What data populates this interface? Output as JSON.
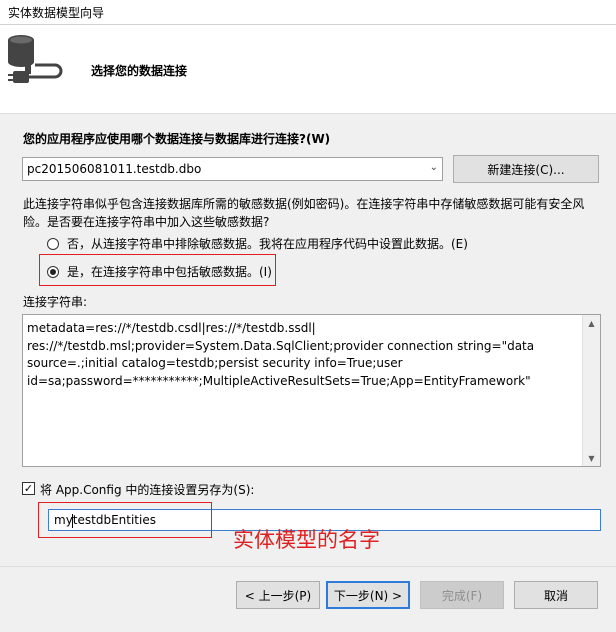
{
  "window": {
    "title": "实体数据模型向导"
  },
  "header": {
    "subtitle": "选择您的数据连接"
  },
  "connection_question": "您的应用程序应使用哪个数据连接与数据库进行连接?(W)",
  "connection_select": {
    "value": "pc201506081011.testdb.dbo"
  },
  "new_connection_label": "新建连接(C)...",
  "warning_text": "此连接字符串似乎包含连接数据库所需的敏感数据(例如密码)。在连接字符串中存储敏感数据可能有安全风险。是否要在连接字符串中加入这些敏感数据?",
  "options": {
    "exclude_label": "否，从连接字符串中排除敏感数据。我将在应用程序代码中设置此数据。(E)",
    "include_label": "是，在连接字符串中包括敏感数据。(I)",
    "selected": "include"
  },
  "connection_string_label": "连接字符串:",
  "connection_string": "metadata=res://*/testdb.csdl|res://*/testdb.ssdl|\nres://*/testdb.msl;provider=System.Data.SqlClient;provider connection string=\"data\nsource=.;initial catalog=testdb;persist security info=True;user\nid=sa;password=***********;MultipleActiveResultSets=True;App=EntityFramework\"",
  "save_config": {
    "checked": true,
    "label": "将 App.Config 中的连接设置另存为(S):"
  },
  "entities_name": "mytestdbEntities",
  "annotation": "实体模型的名字",
  "buttons": {
    "prev": "< 上一步(P)",
    "next": "下一步(N) >",
    "finish": "完成(F)",
    "cancel": "取消"
  },
  "colors": {
    "highlight": "#e02020",
    "focus": "#2f7bd9"
  }
}
